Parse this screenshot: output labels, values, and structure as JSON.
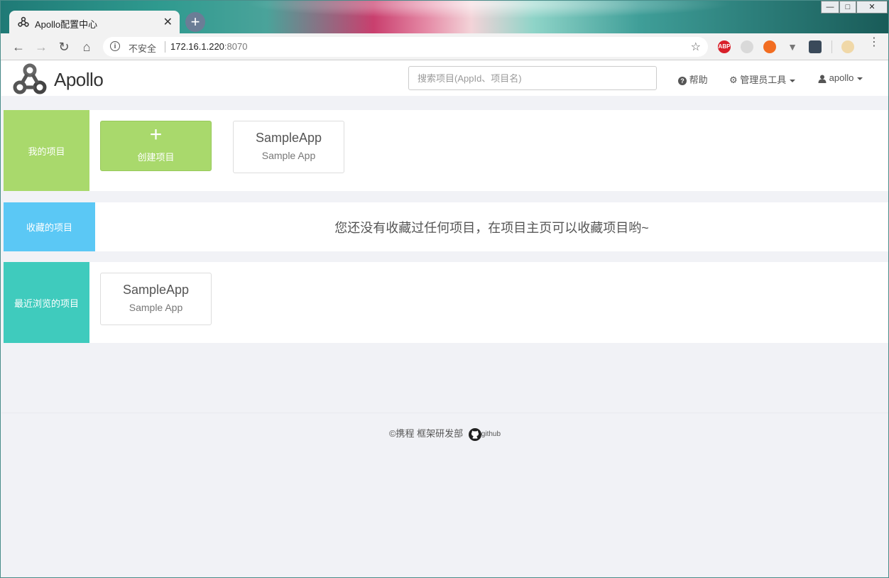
{
  "browser": {
    "tab_title": "Apollo配置中心",
    "tab_close": "✕",
    "new_tab": "+",
    "win_min": "—",
    "win_max": "□",
    "win_close": "✕",
    "security_label": "不安全",
    "url_host": "172.16.1.220",
    "url_port": ":8070",
    "extensions": [
      "ABP"
    ]
  },
  "navbar": {
    "logo_text": "Apollo",
    "search_placeholder": "搜索项目(AppId、项目名)",
    "help": "帮助",
    "admin_tools": "管理员工具",
    "user": "apollo"
  },
  "sections": {
    "mine": {
      "label": "我的项目",
      "create_label": "创建项目",
      "create_icon": "+",
      "apps": [
        {
          "id": "SampleApp",
          "name": "Sample App"
        }
      ]
    },
    "favorites": {
      "label": "收藏的项目",
      "empty_message": "您还没有收藏过任何项目，在项目主页可以收藏项目哟~"
    },
    "recent": {
      "label": "最近浏览的项目",
      "apps": [
        {
          "id": "SampleApp",
          "name": "Sample App"
        }
      ]
    }
  },
  "footer": {
    "copyright_symbol": "©",
    "text": "携程 框架研发部",
    "github": "github"
  },
  "colors": {
    "mine": "#a9d96c",
    "favorites": "#5bc8f5",
    "recent": "#3fcbbd"
  }
}
